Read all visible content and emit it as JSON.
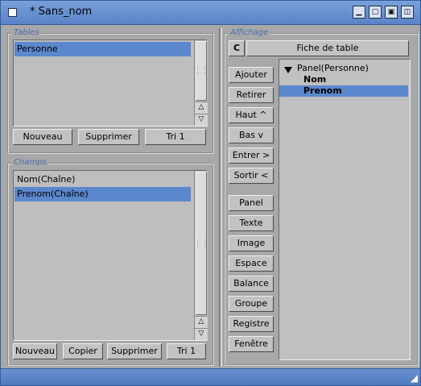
{
  "window": {
    "title": "* Sans_nom",
    "buttons": [
      "minimize-icon",
      "zoom-icon",
      "depth-icon",
      "iconify-icon"
    ]
  },
  "tables": {
    "group_label": "Tables",
    "items": [
      {
        "label": "Personne",
        "selected": true
      }
    ],
    "buttons": {
      "nouveau": "Nouveau",
      "supprimer": "Supprimer",
      "tri": "Tri 1"
    }
  },
  "champs": {
    "group_label": "Champs",
    "items": [
      {
        "label": "Nom(Chaîne)",
        "selected": false
      },
      {
        "label": "Prenom(Chaîne)",
        "selected": true
      }
    ],
    "buttons": {
      "nouveau": "Nouveau",
      "copier": "Copier",
      "supprimer": "Supprimer",
      "tri": "Tri 1"
    }
  },
  "affichage": {
    "group_label": "Affichage",
    "cycle_label": "C",
    "mode": "Fiche de table",
    "buttons": {
      "ajouter": "Ajouter",
      "retirer": "Retirer",
      "haut": "Haut ^",
      "bas": "Bas v",
      "entrer": "Entrer >",
      "sortir": "Sortir <",
      "panel": "Panel",
      "texte": "Texte",
      "image": "Image",
      "espace": "Espace",
      "balance": "Balance",
      "groupe": "Groupe",
      "registre": "Registre",
      "fenetre": "Fenêtre"
    },
    "tree": {
      "root": "Panel(Personne)",
      "children": [
        {
          "label": "Nom",
          "selected": false
        },
        {
          "label": "Prenom",
          "selected": true
        }
      ]
    }
  }
}
